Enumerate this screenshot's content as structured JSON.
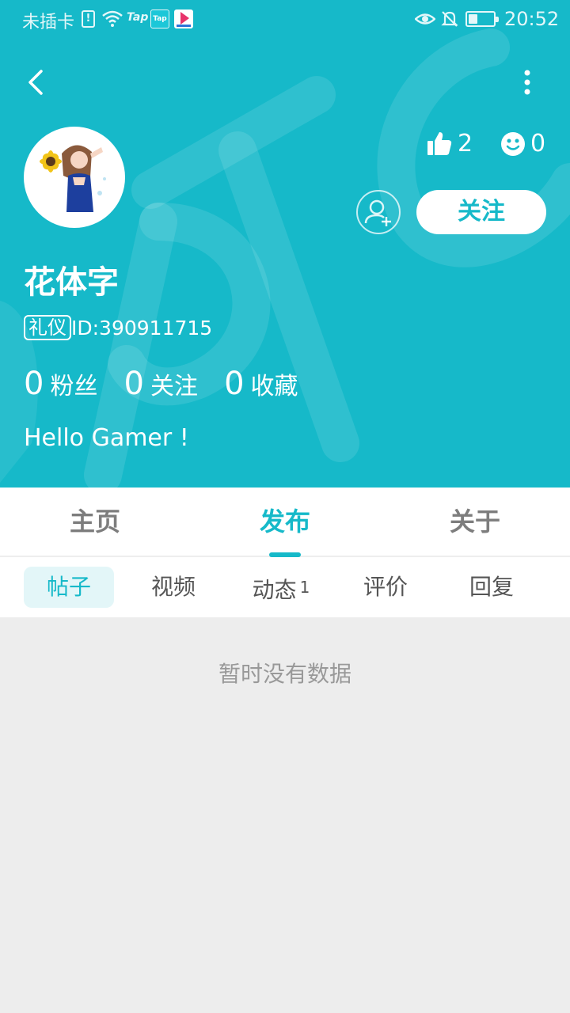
{
  "status_bar": {
    "carrier": "未插卡",
    "sim_icon": "!",
    "app_icon_1": "Tap",
    "app_icon_2": "Tap",
    "time": "20:52",
    "battery_level": 0.35
  },
  "profile": {
    "likes_count": "2",
    "smiles_count": "0",
    "follow_label": "关注",
    "username": "花体字",
    "badge": "礼仪",
    "user_id": "ID:390911715",
    "stats": [
      {
        "count": "0",
        "label": "粉丝"
      },
      {
        "count": "0",
        "label": "关注"
      },
      {
        "count": "0",
        "label": "收藏"
      }
    ],
    "bio": "Hello Gamer !"
  },
  "tabs": [
    {
      "label": "主页"
    },
    {
      "label": "发布"
    },
    {
      "label": "关于"
    }
  ],
  "active_tab": "发布",
  "subtabs": [
    {
      "label": "帖子",
      "count": ""
    },
    {
      "label": "视频",
      "count": ""
    },
    {
      "label": "动态",
      "count": "1"
    },
    {
      "label": "评价",
      "count": ""
    },
    {
      "label": "回复",
      "count": ""
    }
  ],
  "empty_message": "暂时没有数据",
  "colors": {
    "brand": "#16b9c9",
    "active_subtab_bg": "#e3f6f8",
    "page_bg": "#ededed"
  },
  "icons": {
    "back": "chevron-left-icon",
    "more": "more-vertical-icon",
    "like": "thumbs-up-icon",
    "smile": "smile-icon",
    "add_friend": "add-user-icon",
    "wifi": "wifi-icon",
    "eye": "eye-icon",
    "bell": "bell-off-icon",
    "battery": "battery-icon"
  }
}
